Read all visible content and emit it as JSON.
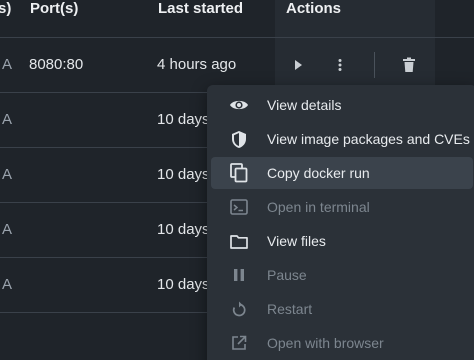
{
  "table": {
    "columns": {
      "partial": "s)",
      "ports": "Port(s)",
      "last_started": "Last started",
      "actions": "Actions"
    },
    "rows": [
      {
        "status": "A",
        "ports": "8080:80",
        "last_started": "4 hours ago"
      },
      {
        "status": "A",
        "ports": "",
        "last_started": "10 days"
      },
      {
        "status": "A",
        "ports": "",
        "last_started": "10 days"
      },
      {
        "status": "A",
        "ports": "",
        "last_started": "10 days"
      },
      {
        "status": "A",
        "ports": "",
        "last_started": "10 days"
      }
    ]
  },
  "row_actions": {
    "start_icon": "play-icon",
    "more_icon": "more-vertical-icon",
    "delete_icon": "trash-icon"
  },
  "context_menu": {
    "items": [
      {
        "label": "View details",
        "icon": "eye-icon",
        "disabled": false
      },
      {
        "label": "View image packages and CVEs",
        "icon": "shield-icon",
        "disabled": false
      },
      {
        "label": "Copy docker run",
        "icon": "copy-icon",
        "disabled": false,
        "hovered": true
      },
      {
        "label": "Open in terminal",
        "icon": "terminal-icon",
        "disabled": true
      },
      {
        "label": "View files",
        "icon": "folder-icon",
        "disabled": false
      },
      {
        "label": "Pause",
        "icon": "pause-icon",
        "disabled": true
      },
      {
        "label": "Restart",
        "icon": "restart-icon",
        "disabled": true
      },
      {
        "label": "Open with browser",
        "icon": "open-external-icon",
        "disabled": true
      }
    ]
  },
  "colors": {
    "background": "#1f242a",
    "menu_background": "#2b3138",
    "hover": "#3b434c",
    "text": "#e4e7ea",
    "disabled_text": "#7d868f"
  }
}
